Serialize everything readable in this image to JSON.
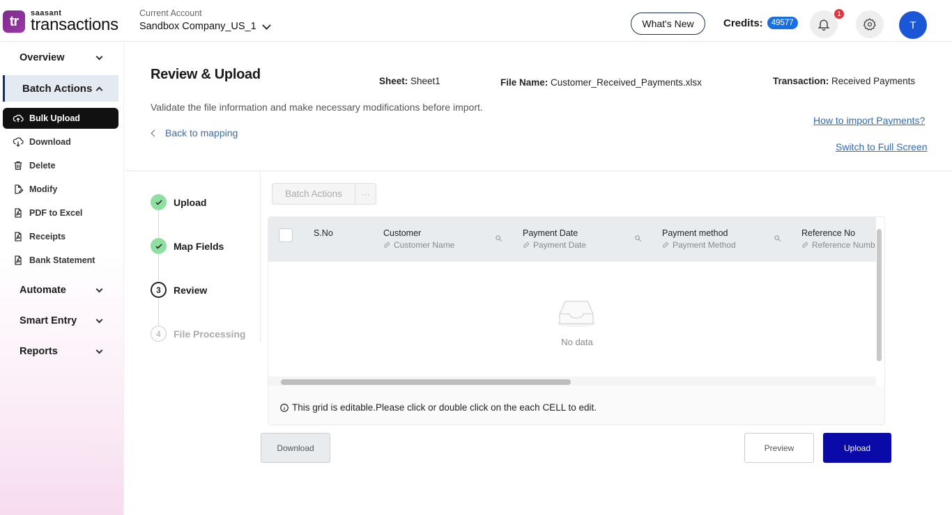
{
  "header": {
    "logo_small": "saasant",
    "logo_big": "transactions",
    "logo_mark": "tr",
    "account_label": "Current Account",
    "account_name": "Sandbox Company_US_1",
    "whats_new": "What's New",
    "credits_label": "Credits:",
    "credits_value": "49577",
    "notification_count": "1",
    "avatar_initial": "T"
  },
  "sidebar": {
    "sections": [
      {
        "label": "Overview"
      },
      {
        "label": "Batch Actions"
      },
      {
        "label": "Automate"
      },
      {
        "label": "Smart Entry"
      },
      {
        "label": "Reports"
      }
    ],
    "items": [
      {
        "label": "Bulk Upload",
        "icon": "upload-cloud-icon"
      },
      {
        "label": "Download",
        "icon": "download-cloud-icon"
      },
      {
        "label": "Delete",
        "icon": "trash-icon"
      },
      {
        "label": "Modify",
        "icon": "edit-file-icon"
      },
      {
        "label": "PDF to Excel",
        "icon": "pdf-file-icon"
      },
      {
        "label": "Receipts",
        "icon": "receipt-icon"
      },
      {
        "label": "Bank Statement",
        "icon": "statement-icon"
      }
    ]
  },
  "main": {
    "title": "Review & Upload",
    "sheet_label": "Sheet:",
    "sheet_value": "Sheet1",
    "file_label": "File Name:",
    "file_value": "Customer_Received_Payments.xlsx",
    "transaction_label": "Transaction:",
    "transaction_value": "Received Payments",
    "subtitle": "Validate the file information and make necessary modifications before import.",
    "back_link": "Back to mapping",
    "help_link": "How to import Payments?",
    "fullscreen_link": "Switch to Full Screen"
  },
  "steps": [
    {
      "label": "Upload",
      "num": ""
    },
    {
      "label": "Map Fields",
      "num": ""
    },
    {
      "label": "Review",
      "num": "3"
    },
    {
      "label": "File Processing",
      "num": "4"
    }
  ],
  "grid": {
    "batch_actions": "Batch Actions",
    "more": "···",
    "columns": [
      {
        "title": "S.No",
        "sub": ""
      },
      {
        "title": "Customer",
        "sub": "Customer Name"
      },
      {
        "title": "Payment Date",
        "sub": "Payment Date"
      },
      {
        "title": "Payment method",
        "sub": "Payment Method"
      },
      {
        "title": "Reference No",
        "sub": "Reference Numb"
      }
    ],
    "empty_text": "No data",
    "note": "This grid is editable.Please click or double click on the each CELL to edit."
  },
  "buttons": {
    "download": "Download",
    "preview": "Preview",
    "upload": "Upload"
  },
  "colors": {
    "primary": "#0a0aa8",
    "credits_badge": "#1a6fe0",
    "step_done": "#8fe0a0",
    "link": "#2a6ac0",
    "notification": "#e8343a"
  }
}
